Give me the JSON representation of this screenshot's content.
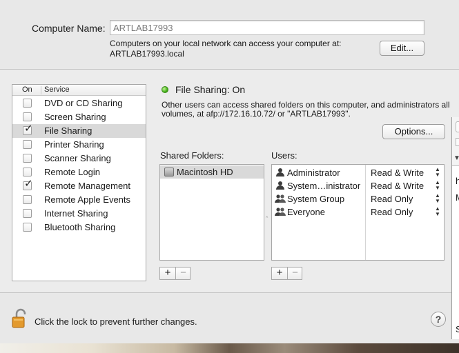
{
  "computer_name": {
    "label": "Computer Name:",
    "value": "ARTLAB17993",
    "description_line1": "Computers on your local network can access your computer at:",
    "description_line2": "ARTLAB17993.local",
    "edit_button": "Edit..."
  },
  "services": {
    "header_on": "On",
    "header_service": "Service",
    "items": [
      {
        "label": "DVD or CD Sharing",
        "checked": false,
        "selected": false
      },
      {
        "label": "Screen Sharing",
        "checked": false,
        "selected": false
      },
      {
        "label": "File Sharing",
        "checked": true,
        "selected": true
      },
      {
        "label": "Printer Sharing",
        "checked": false,
        "selected": false
      },
      {
        "label": "Scanner Sharing",
        "checked": false,
        "selected": false
      },
      {
        "label": "Remote Login",
        "checked": false,
        "selected": false
      },
      {
        "label": "Remote Management",
        "checked": true,
        "selected": false
      },
      {
        "label": "Remote Apple Events",
        "checked": false,
        "selected": false
      },
      {
        "label": "Internet Sharing",
        "checked": false,
        "selected": false
      },
      {
        "label": "Bluetooth Sharing",
        "checked": false,
        "selected": false
      }
    ],
    "check_glyph": "✓"
  },
  "detail": {
    "status_text": "File Sharing: On",
    "status_color": "#45b21a",
    "description": "Other users can access shared folders on this computer, and administrators all volumes, at afp://172.16.10.72/ or \"ARTLAB17993\".",
    "options_button": "Options...",
    "shared_folders_label": "Shared Folders:",
    "users_label": "Users:",
    "shared_folders": [
      {
        "name": "Macintosh HD",
        "icon": "hard-drive-icon"
      }
    ],
    "users": [
      {
        "name": "Administrator",
        "permission": "Read & Write",
        "icon": "user-icon"
      },
      {
        "name": "System…inistrator",
        "permission": "Read & Write",
        "icon": "user-icon"
      },
      {
        "name": "System Group",
        "permission": "Read Only",
        "icon": "group-icon"
      },
      {
        "name": "Everyone",
        "permission": "Read Only",
        "icon": "group-icon"
      }
    ],
    "plus": "+",
    "minus": "−",
    "stepper_glyph": "▲▼"
  },
  "footer": {
    "lock_text": "Click the lock to prevent further changes.",
    "help_label": "?"
  },
  "side_window": {
    "text1": "h",
    "text2": "M",
    "text3": "S"
  }
}
